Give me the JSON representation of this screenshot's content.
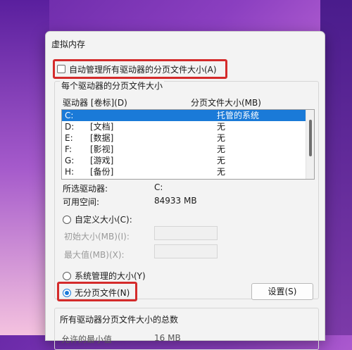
{
  "dialog": {
    "title": "虚拟内存",
    "auto_manage_label": "自动管理所有驱动器的分页文件大小(A)",
    "group_title": "每个驱动器的分页文件大小",
    "col_drive": "驱动器 [卷标](D)",
    "col_size": "分页文件大小(MB)",
    "drives": [
      {
        "drive": "C:",
        "label": "",
        "size": "托管的系统",
        "selected": true
      },
      {
        "drive": "D:",
        "label": "[文档]",
        "size": "无",
        "selected": false
      },
      {
        "drive": "E:",
        "label": "[数据]",
        "size": "无",
        "selected": false
      },
      {
        "drive": "F:",
        "label": "[影视]",
        "size": "无",
        "selected": false
      },
      {
        "drive": "G:",
        "label": "[游戏]",
        "size": "无",
        "selected": false
      },
      {
        "drive": "H:",
        "label": "[备份]",
        "size": "无",
        "selected": false
      }
    ],
    "selected_drive_label": "所选驱动器:",
    "selected_drive_value": "C:",
    "free_space_label": "可用空间:",
    "free_space_value": "84933 MB",
    "custom_size_label": "自定义大小(C):",
    "initial_size_label": "初始大小(MB)(I):",
    "max_size_label": "最大值(MB)(X):",
    "system_managed_label": "系统管理的大小(Y)",
    "no_paging_label": "无分页文件(N)",
    "set_button": "设置(S)",
    "total_group_title": "所有驱动器分页文件大小的总数",
    "partial_row_label": "允许的最小值",
    "partial_row_value": "16 MB",
    "selected_option": "no_paging"
  },
  "colors": {
    "highlight": "#d42b2b",
    "selection": "#1a7ad8"
  }
}
